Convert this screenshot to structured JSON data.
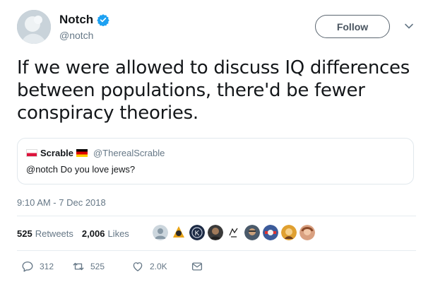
{
  "user": {
    "display_name": "Notch",
    "handle": "@notch",
    "verified_icon": "verified-badge-icon"
  },
  "follow_label": "Follow",
  "tweet_text": "If we were allowed to discuss IQ differences between populations, there'd be fewer conspiracy theories.",
  "quote": {
    "display_name": "Scrable",
    "handle": "@TherealScrable",
    "text": "@notch Do you love jews?"
  },
  "timestamp": "9:10 AM - 7 Dec 2018",
  "stats": {
    "retweets_count": "525",
    "retweets_label": "Retweets",
    "likes_count": "2,006",
    "likes_label": "Likes"
  },
  "actions": {
    "reply_count": "312",
    "retweet_count": "525",
    "like_count": "2.0K"
  },
  "colors": {
    "text": "#14171a",
    "secondary": "#657786",
    "verified": "#1da1f2",
    "border": "#e1e8ed"
  }
}
